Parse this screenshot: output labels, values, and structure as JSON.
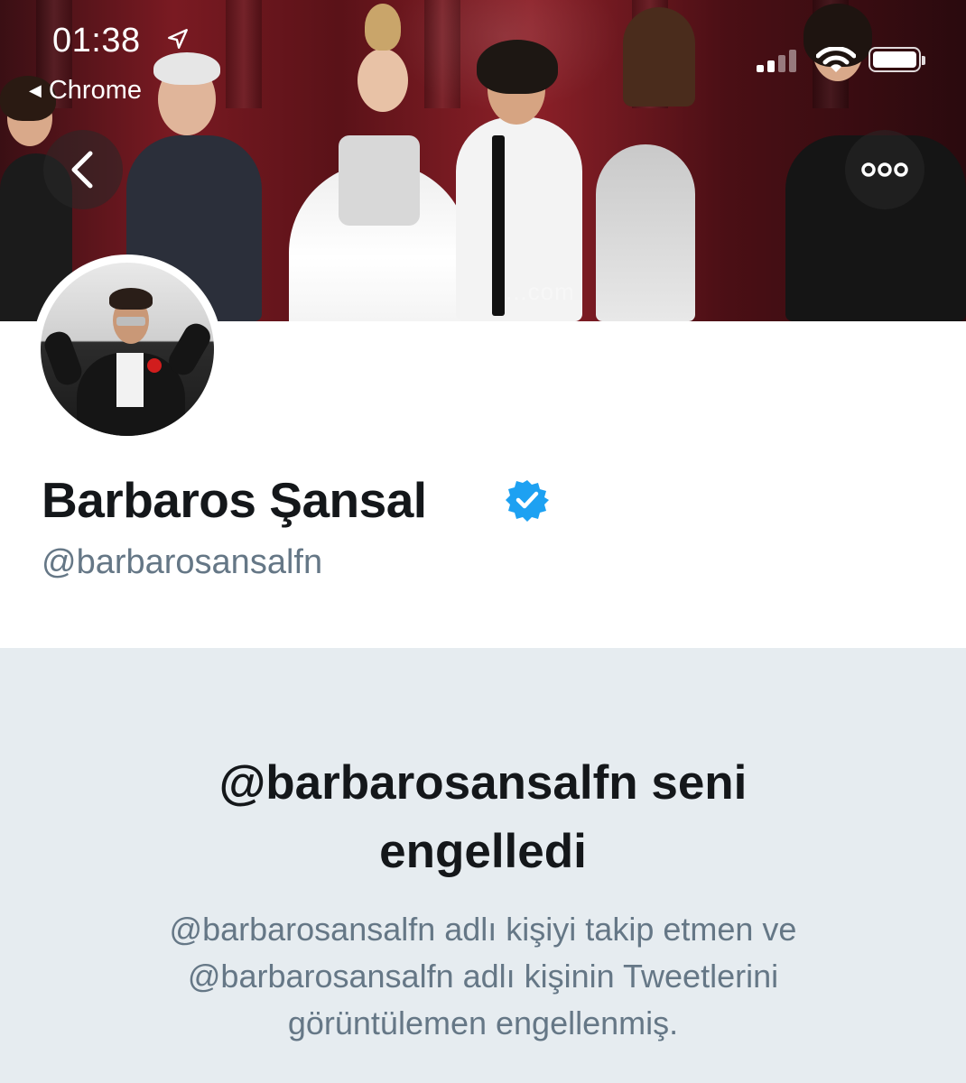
{
  "status_bar": {
    "time": "01:38",
    "back_app": "Chrome"
  },
  "banner": {
    "watermark": "...com"
  },
  "profile": {
    "display_name": "Barbaros Şansal",
    "handle": "@barbarosansalfn",
    "verified": true
  },
  "blocked": {
    "title_line1": "@barbarosansalfn seni",
    "title_line2": "engelledi",
    "desc_line1": "@barbarosansalfn adlı kişiyi takip etmen ve",
    "desc_line2": "@barbarosansalfn adlı kişinin Tweetlerini",
    "desc_line3": "görüntülemen engellenmiş."
  },
  "colors": {
    "name_text": "#14171a",
    "secondary_text": "#657786",
    "verified_blue": "#1da1f2",
    "panel_bg": "#e6ecf0"
  },
  "icons": {
    "back": "chevron-left-icon",
    "more": "more-dots-icon",
    "verified": "verified-badge-icon"
  }
}
